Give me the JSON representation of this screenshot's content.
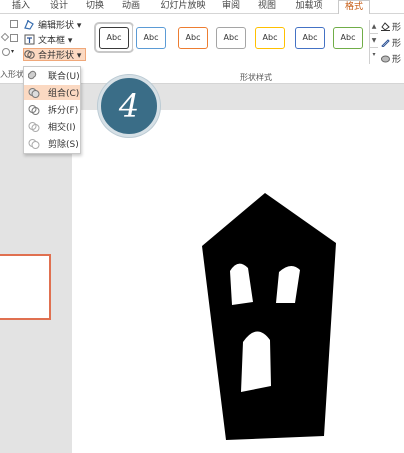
{
  "ribbon": {
    "tabs": [
      {
        "label": "插入",
        "active": false
      },
      {
        "label": "设计",
        "active": false
      },
      {
        "label": "切换",
        "active": false
      },
      {
        "label": "动画",
        "active": false
      },
      {
        "label": "幻灯片放映",
        "active": false
      },
      {
        "label": "审阅",
        "active": false
      },
      {
        "label": "视图",
        "active": false
      },
      {
        "label": "加载项",
        "active": false
      },
      {
        "label": "格式",
        "active": true
      }
    ],
    "left_group_label": "入形状",
    "commands": {
      "edit_shape": "编辑形状 ▾",
      "text_box": "文本框 ▾",
      "merge_shapes": "合并形状 ▾"
    },
    "shape_styles": {
      "label": "形状样式",
      "items": [
        {
          "text": "Abc",
          "border": "#3a3a3a",
          "selected": true
        },
        {
          "text": "Abc",
          "border": "#5b9bd5",
          "selected": false
        },
        {
          "text": "Abc",
          "border": "#ed7d31",
          "selected": false
        },
        {
          "text": "Abc",
          "border": "#a5a5a5",
          "selected": false
        },
        {
          "text": "Abc",
          "border": "#ffc000",
          "selected": false
        },
        {
          "text": "Abc",
          "border": "#4472c4",
          "selected": false
        },
        {
          "text": "Abc",
          "border": "#70ad47",
          "selected": false
        }
      ]
    },
    "right_commands": [
      {
        "icon": "fill-bucket-icon",
        "label": "形"
      },
      {
        "icon": "pen-outline-icon",
        "label": "形"
      },
      {
        "icon": "effects-icon",
        "label": "形"
      }
    ]
  },
  "merge_menu": {
    "items": [
      {
        "label": "联合(U)",
        "icon": "union-icon",
        "highlighted": false
      },
      {
        "label": "组合(C)",
        "icon": "combine-icon",
        "highlighted": true
      },
      {
        "label": "拆分(F)",
        "icon": "fragment-icon",
        "highlighted": false
      },
      {
        "label": "相交(I)",
        "icon": "intersect-icon",
        "highlighted": false
      },
      {
        "label": "剪除(S)",
        "icon": "subtract-icon",
        "highlighted": false
      }
    ]
  },
  "step_badge": "4",
  "colors": {
    "accent": "#c55a11",
    "highlight": "#fbd9c2",
    "badge": "#3a6d87",
    "shape": "#000000"
  }
}
